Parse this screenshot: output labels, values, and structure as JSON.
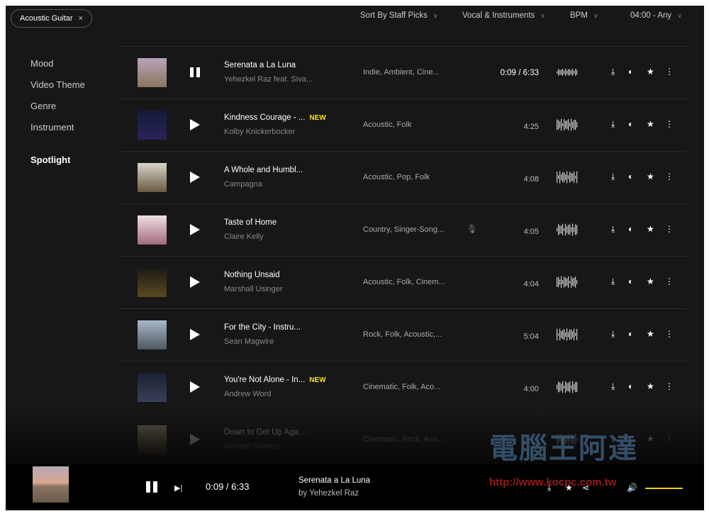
{
  "filter_chip": {
    "label": "Acoustic Guitar",
    "close": "×"
  },
  "filters": [
    {
      "label": "Sort By Staff Picks"
    },
    {
      "label": "Vocal & Instruments"
    },
    {
      "label": "BPM"
    },
    {
      "label": "04:00 - Any"
    }
  ],
  "sidebar": {
    "items": [
      {
        "label": "Mood"
      },
      {
        "label": "Video Theme"
      },
      {
        "label": "Genre"
      },
      {
        "label": "Instrument"
      }
    ],
    "spotlight": "Spotlight"
  },
  "tracks": [
    {
      "title": "Serenata a La Luna",
      "artist": "Yehezkel Raz feat. Siva...",
      "genres": "Indie,  Ambient,  Cine...",
      "duration": "0:09 / 6:33",
      "playing": true,
      "new": "",
      "thumb": [
        "#b9a3b8",
        "#8c7560"
      ]
    },
    {
      "title": "Kindness Courage - ...",
      "artist": "Kolby Knickerbocker",
      "genres": "Acoustic,  Folk",
      "duration": "4:25",
      "playing": false,
      "new": "NEW",
      "thumb": [
        "#141a3a",
        "#2a2458"
      ]
    },
    {
      "title": "A Whole and Humbl...",
      "artist": "Campagna",
      "genres": "Acoustic,  Pop,  Folk",
      "duration": "4:08",
      "playing": false,
      "new": "",
      "thumb": [
        "#d8d4cc",
        "#6a5a40"
      ]
    },
    {
      "title": "Taste of Home",
      "artist": "Claire Kelly",
      "genres": "Country,  Singer-Song...",
      "duration": "4:05",
      "playing": false,
      "new": "",
      "mic": true,
      "thumb": [
        "#f0e0e0",
        "#a06a80"
      ]
    },
    {
      "title": "Nothing Unsaid",
      "artist": "Marshall Usinger",
      "genres": "Acoustic,  Folk,  Cinem...",
      "duration": "4:04",
      "playing": false,
      "new": "",
      "thumb": [
        "#1a1a14",
        "#5a4a20"
      ]
    },
    {
      "title": "For the City - Instru...",
      "artist": "Sean Magwire",
      "genres": "Rock,  Folk,  Acoustic,...",
      "duration": "5:04",
      "playing": false,
      "new": "",
      "thumb": [
        "#a8b8c8",
        "#505860"
      ]
    },
    {
      "title": "You're Not Alone - In...",
      "artist": "Andrew Word",
      "genres": "Cinematic,  Folk,  Aco...",
      "duration": "4:00",
      "playing": false,
      "new": "NEW",
      "thumb": [
        "#1a2030",
        "#3a4058"
      ]
    },
    {
      "title": "Down to Get Up Aga...",
      "artist": "Michael Shynes",
      "genres": "Cinematic,  Rock,  Aco...",
      "duration": "4:15",
      "playing": false,
      "new": "",
      "thumb": [
        "#c8b890",
        "#4a3a28"
      ]
    }
  ],
  "player": {
    "time": "0:09 / 6:33",
    "title": "Serenata a La Luna",
    "artist": "by Yehezkel Raz",
    "volume": 0.85
  },
  "watermark": {
    "text": "電腦王阿達",
    "url": "http://www.kocpc.com.tw"
  },
  "colors": {
    "background": "#171717",
    "accent_new": "#f5e11b",
    "volume": "#f0d000"
  }
}
